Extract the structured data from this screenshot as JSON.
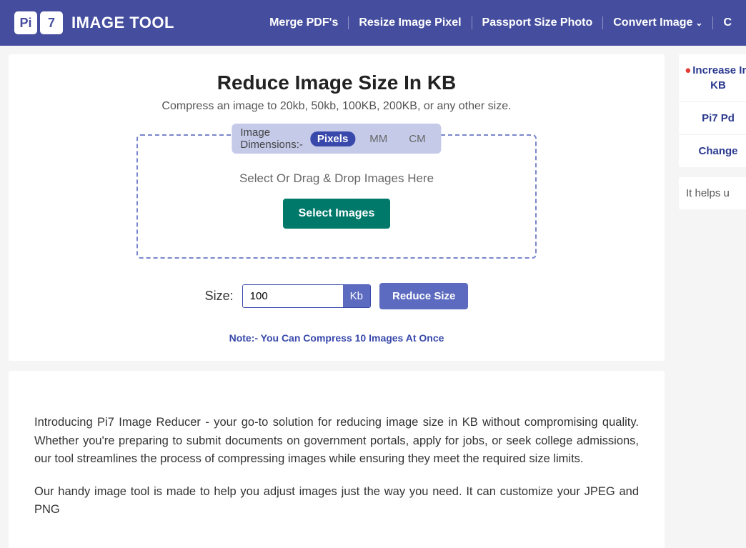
{
  "header": {
    "logo_s1": "Pi",
    "logo_s2": "7",
    "logo_title": "IMAGE TOOL",
    "nav": {
      "merge": "Merge PDF's",
      "resize": "Resize Image Pixel",
      "passport": "Passport Size Photo",
      "convert": "Convert Image",
      "last": "C"
    }
  },
  "main": {
    "title": "Reduce Image Size In KB",
    "subtitle": "Compress an image to 20kb, 50kb, 100KB, 200KB, or any other size.",
    "dim_label": "Image Dimensions:-",
    "dim_pixels": "Pixels",
    "dim_mm": "MM",
    "dim_cm": "CM",
    "drop_text": "Select Or Drag & Drop Images Here",
    "select_btn": "Select Images",
    "size_label": "Size:",
    "size_value": "100",
    "size_unit": "Kb",
    "reduce_btn": "Reduce Size",
    "note": "Note:- You Can Compress 10 Images At Once"
  },
  "article": {
    "p1": "Introducing Pi7 Image Reducer - your go-to solution for reducing image size in KB without compromising quality. Whether you're preparing to submit documents on government portals, apply for jobs, or seek college admissions, our tool streamlines the process of compressing images while ensuring they meet the required size limits.",
    "p2": "Our handy image tool is made to help you adjust images just the way you need. It can customize your JPEG and PNG"
  },
  "sidebar": {
    "increase_l1": "Increase Im",
    "increase_l2": "KB",
    "pi7pd": "Pi7 Pd",
    "change": "Change",
    "helps": "It helps u"
  }
}
